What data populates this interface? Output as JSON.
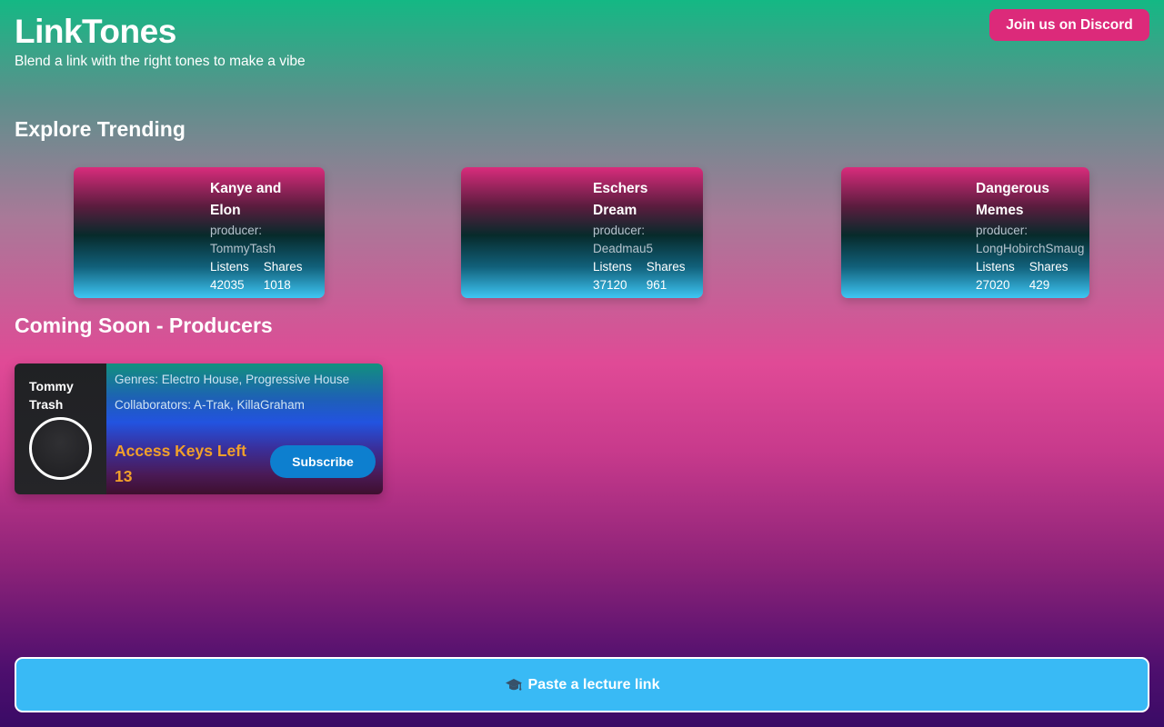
{
  "header": {
    "title": "LinkTones",
    "subtitle": "Blend a link with the right tones to make a vibe",
    "discord_label": "Join us on Discord"
  },
  "trending": {
    "title": "Explore Trending",
    "cards": [
      {
        "title": "Kanye and Elon",
        "producer_label": "producer:",
        "producer": "TommyTash",
        "listens_label": "Listens",
        "listens": "42035",
        "shares_label": "Shares",
        "shares": "1018"
      },
      {
        "title": "Eschers Dream",
        "producer_label": "producer:",
        "producer": "Deadmau5",
        "listens_label": "Listens",
        "listens": "37120",
        "shares_label": "Shares",
        "shares": "961"
      },
      {
        "title": "Dangerous Memes",
        "producer_label": "producer:",
        "producer": "LongHobirchSmaug",
        "listens_label": "Listens",
        "listens": "27020",
        "shares_label": "Shares",
        "shares": "429"
      }
    ]
  },
  "producers": {
    "title": "Coming Soon - Producers",
    "card": {
      "name": "Tommy Trash",
      "genres": "Genres: Electro House, Progressive House",
      "collaborators": "Collaborators: A-Trak, KillaGraham",
      "access_label": "Access Keys Left",
      "access_count": "13",
      "subscribe_label": "Subscribe"
    }
  },
  "lecture_button": {
    "icon": "graduation-cap-icon",
    "label": "Paste a lecture link"
  },
  "colors": {
    "accent_pink": "#dc2a7a",
    "lecture_blue": "#39baf5",
    "subscribe_blue": "#0d7fcf",
    "access_orange": "#f1a02a"
  }
}
